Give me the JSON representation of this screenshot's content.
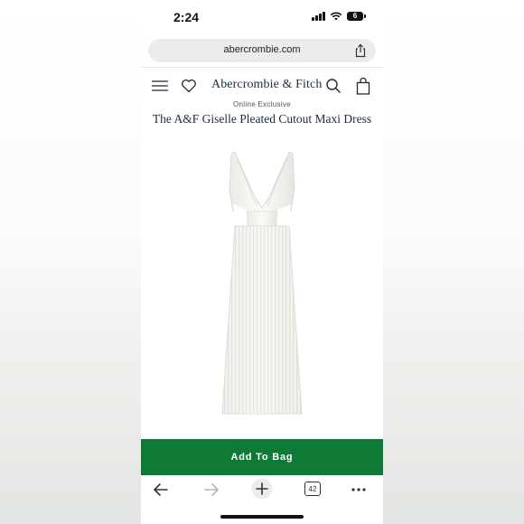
{
  "status_bar": {
    "time": "2:24",
    "battery_level": "6"
  },
  "browser": {
    "url": "abercrombie.com",
    "tab_count": "42"
  },
  "header": {
    "brand": "Abercrombie & Fitch"
  },
  "product": {
    "badge": "Online Exclusive",
    "title": "The A&F Giselle Pleated Cutout Maxi Dress",
    "add_to_bag_label": "Add To Bag"
  },
  "icons": {
    "menu": "hamburger-icon",
    "wishlist": "heart-icon",
    "search": "search-icon",
    "bag": "shopping-bag-icon",
    "share": "share-icon",
    "back": "arrow-left-icon",
    "forward": "arrow-right-icon",
    "new_tab": "plus-icon",
    "tabs": "tabs-icon",
    "more": "more-icon"
  },
  "colors": {
    "accent_green": "#0f7a35",
    "brand_navy": "#1b2a3e",
    "url_bar": "#ececee"
  }
}
